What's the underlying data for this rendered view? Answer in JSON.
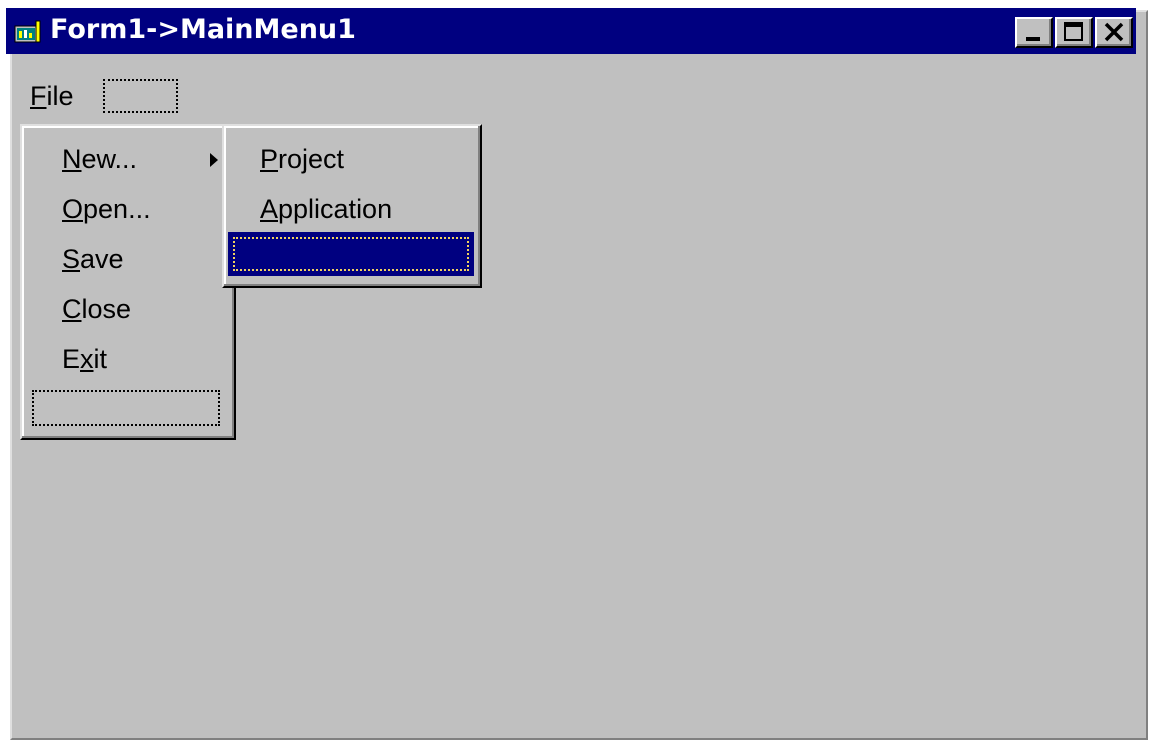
{
  "window": {
    "title": "Form1->MainMenu1",
    "app_icon": "form-designer-icon",
    "controls": {
      "minimize_icon": "minimize-icon",
      "maximize_icon": "maximize-icon",
      "close_icon": "close-icon"
    }
  },
  "menubar": {
    "items": [
      {
        "label": "File",
        "accesskey": "F"
      }
    ],
    "placeholder": ""
  },
  "file_menu": {
    "items": [
      {
        "label": "New...",
        "accesskey": "N",
        "has_submenu": true
      },
      {
        "label": "Open...",
        "accesskey": "O"
      },
      {
        "label": "Save",
        "accesskey": "S"
      },
      {
        "label": "Close",
        "accesskey": "C"
      },
      {
        "label": "Exit",
        "accesskey": "x"
      }
    ],
    "placeholder": ""
  },
  "new_submenu": {
    "items": [
      {
        "label": "Project",
        "accesskey": "P"
      },
      {
        "label": "Application",
        "accesskey": "A"
      }
    ],
    "selected_placeholder": ""
  },
  "colors": {
    "titlebar": "#000080",
    "face": "#c0c0c0",
    "highlight": "#000080",
    "focus_dots": "#f0d060"
  }
}
